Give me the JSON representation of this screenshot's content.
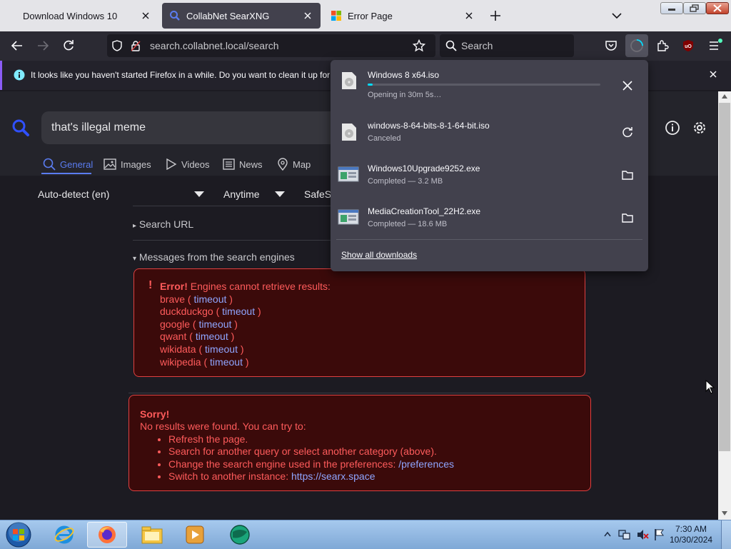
{
  "tabs": [
    {
      "title": "Download Windows 10",
      "icon": "windows-icon"
    },
    {
      "title": "CollabNet SearXNG",
      "icon": "search-icon"
    },
    {
      "title": "Error Page",
      "icon": "windows-icon"
    }
  ],
  "nav": {
    "url": "search.collabnet.local/search",
    "search_placeholder": "Search"
  },
  "notification": {
    "message": "It looks like you haven't started Firefox in a while. Do you want to clean it up for"
  },
  "search": {
    "query": "that's illegal meme",
    "categories": [
      "General",
      "Images",
      "Videos",
      "News",
      "Map"
    ],
    "language": "Auto-detect (en)",
    "time": "Anytime",
    "safe": "SafeS"
  },
  "results": {
    "search_url_label": "Search URL",
    "messages_label": "Messages from the search engines",
    "error_title": "Error!",
    "error_text": "Engines cannot retrieve results:",
    "engines": [
      {
        "name": "brave",
        "status": "timeout"
      },
      {
        "name": "duckduckgo",
        "status": "timeout"
      },
      {
        "name": "google",
        "status": "timeout"
      },
      {
        "name": "qwant",
        "status": "timeout"
      },
      {
        "name": "wikidata",
        "status": "timeout"
      },
      {
        "name": "wikipedia",
        "status": "timeout"
      }
    ],
    "sorry_title": "Sorry!",
    "sorry_text": "No results were found. You can try to:",
    "suggestions": [
      {
        "text": "Refresh the page.",
        "link": ""
      },
      {
        "text": "Search for another query or select another category (above).",
        "link": ""
      },
      {
        "text": "Change the search engine used in the preferences: ",
        "link": "/preferences"
      },
      {
        "text": "Switch to another instance: ",
        "link": "https://searx.space"
      }
    ]
  },
  "downloads": {
    "items": [
      {
        "name": "Windows 8 x64.iso",
        "status": "Opening in 30m 5s…",
        "progress": 0.01,
        "action": "cancel"
      },
      {
        "name": "windows-8-64-bits-8-1-64-bit.iso",
        "status": "Canceled",
        "action": "retry"
      },
      {
        "name": "Windows10Upgrade9252.exe",
        "status": "Completed — 3.2 MB",
        "action": "open-folder"
      },
      {
        "name": "MediaCreationTool_22H2.exe",
        "status": "Completed — 18.6 MB",
        "action": "open-folder"
      }
    ],
    "show_all": "Show all downloads"
  },
  "taskbar": {
    "time": "7:30 AM",
    "date": "10/30/2024"
  },
  "colors": {
    "accent": "#8fa5ff",
    "error": "#ff5b5b",
    "error_bg": "#3b0a0a",
    "progress": "#00ddff"
  }
}
